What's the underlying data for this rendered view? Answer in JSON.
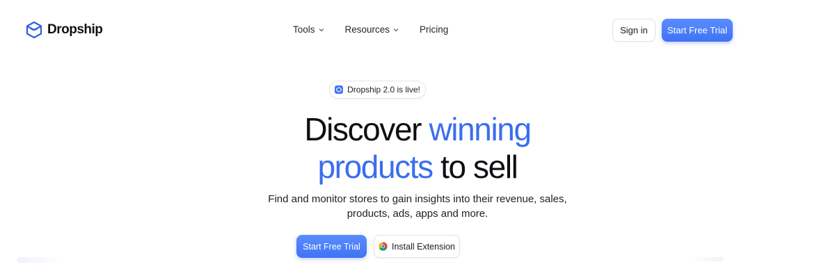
{
  "brand": {
    "name": "Dropship",
    "logo_icon": "package-box-icon",
    "accent_color": "#3a6df0"
  },
  "nav": {
    "items": [
      {
        "label": "Tools",
        "has_dropdown": true
      },
      {
        "label": "Resources",
        "has_dropdown": true
      },
      {
        "label": "Pricing",
        "has_dropdown": false
      }
    ],
    "sign_in": "Sign in",
    "cta": "Start Free Trial"
  },
  "hero": {
    "badge": "Dropship 2.0 is live!",
    "title_line1_plain": "Discover ",
    "title_line1_accent": "winning",
    "title_line2_accent": "products",
    "title_line2_plain": " to sell",
    "subtitle_line1": "Find and monitor stores to gain insights into their revenue, sales,",
    "subtitle_line2": "products, ads, apps and more.",
    "cta_primary": "Start Free Trial",
    "cta_secondary": "Install Extension",
    "cta_secondary_icon": "chrome-icon"
  }
}
